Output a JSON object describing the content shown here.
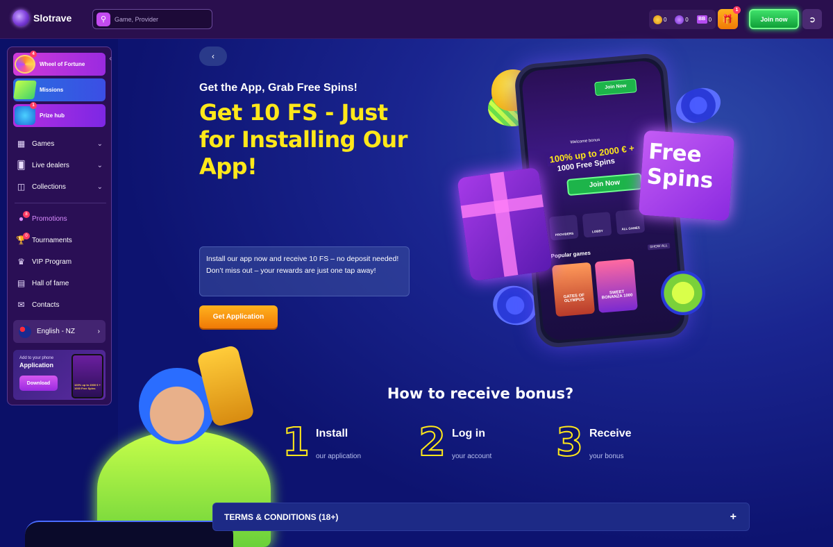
{
  "header": {
    "logo_text": "Slotrave",
    "search_placeholder": "Game, Provider",
    "balances": [
      {
        "icon": "gold-coin-icon",
        "value": "0"
      },
      {
        "icon": "purple-coin-icon",
        "value": "0"
      },
      {
        "icon": "bb-icon",
        "label": "BB",
        "value": "0"
      }
    ],
    "gift_badge": "1",
    "join_label": "Join now"
  },
  "sidebar": {
    "tiles": [
      {
        "label": "Wheel of Fortune",
        "badge": "4"
      },
      {
        "label": "Missions"
      },
      {
        "label": "Prize hub",
        "badge": "1"
      }
    ],
    "nav": [
      {
        "label": "Games",
        "icon": "games-icon"
      },
      {
        "label": "Live dealers",
        "icon": "cards-icon"
      },
      {
        "label": "Collections",
        "icon": "collection-icon"
      }
    ],
    "nav2": [
      {
        "label": "Promotions",
        "badge": "8"
      },
      {
        "label": "Tournaments",
        "badge": "0"
      },
      {
        "label": "VIP Program"
      },
      {
        "label": "Hall of fame"
      },
      {
        "label": "Contacts"
      }
    ],
    "language": "English - NZ",
    "app_banner": {
      "small": "Add to your phone",
      "big": "Application",
      "button": "Download",
      "mini_text": "100% up to 2000 € + 1000 Free Spins"
    }
  },
  "hero": {
    "subtitle": "Get the App, Grab Free Spins!",
    "title": "Get 10 FS - Just for Installing Our App!",
    "info_line1": "Install our app now and receive 10 FS – no deposit needed!",
    "info_line2": "Don’t miss out – your rewards are just one tap away!",
    "cta": "Get Application"
  },
  "phone": {
    "join": "Join Now",
    "welcome": "Welcome bonus",
    "offer1": "100% up to 2000 € +",
    "offer2": "1000 Free Spins",
    "join2": "Join Now",
    "nav": [
      "PROVIDERS",
      "LOBBY",
      "ALL GAMES"
    ],
    "popular": "Popular games",
    "show_all": "SHOW ALL",
    "games": [
      "GATES OF OLYMPUS",
      "SWEET BONANZA 1000"
    ]
  },
  "free_spins_card": "Free Spins",
  "how_to": {
    "title": "How to receive bonus?",
    "steps": [
      {
        "num": "1",
        "title": "Install",
        "sub": "our application"
      },
      {
        "num": "2",
        "title": "Log in",
        "sub": "your account"
      },
      {
        "num": "3",
        "title": "Receive",
        "sub": "your bonus"
      }
    ]
  },
  "terms_label": "TERMS & CONDITIONS (18+)"
}
